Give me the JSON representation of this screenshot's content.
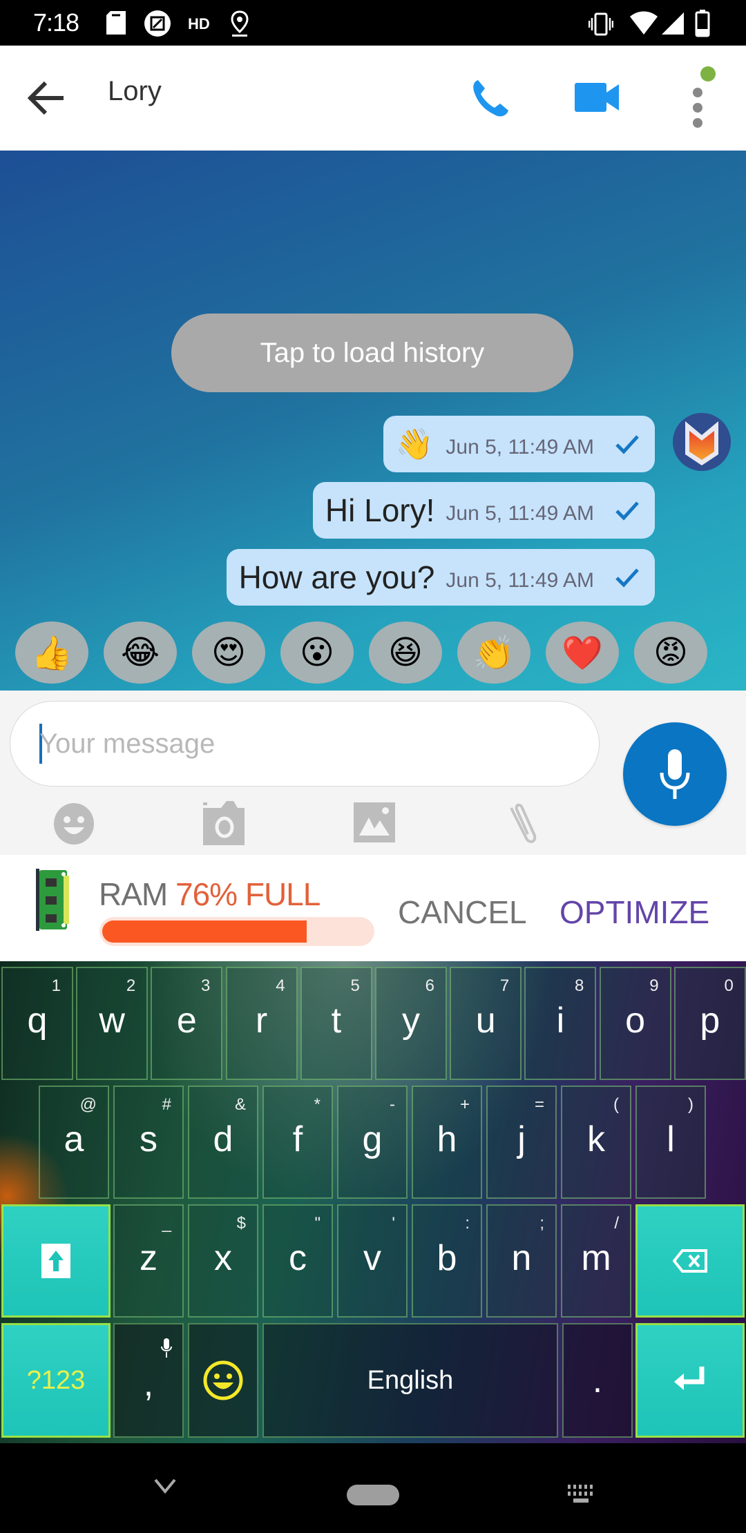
{
  "status_bar": {
    "time": "7:18",
    "left_icons": [
      "shopping-bag-icon",
      "screenshot-icon",
      "hd-icon",
      "location-icon"
    ],
    "right_icons": [
      "vibrate-icon",
      "wifi-icon",
      "signal-icon",
      "battery-icon"
    ]
  },
  "app_bar": {
    "title": "Lory",
    "actions": [
      "back-arrow-icon",
      "phone-icon",
      "video-camera-icon",
      "more-vert-icon"
    ],
    "online_status_color": "#7cb342",
    "accent_color": "#1e96f0"
  },
  "chat": {
    "load_history_label": "Tap to load history",
    "messages": [
      {
        "text": "👋",
        "timestamp": "Jun 5, 11:49 AM",
        "status": "sent",
        "is_emoji": true
      },
      {
        "text": "Hi Lory!",
        "timestamp": "Jun 5, 11:49 AM",
        "status": "sent"
      },
      {
        "text": "How are you?",
        "timestamp": "Jun 5, 11:49 AM",
        "status": "sent"
      }
    ],
    "quick_reactions": [
      "👍",
      "😂",
      "😍",
      "😮",
      "😆",
      "👏",
      "❤️",
      "😡"
    ]
  },
  "composer": {
    "placeholder": "Your message",
    "value": "",
    "tools": [
      "emoji-icon",
      "camera-icon",
      "gallery-icon",
      "attachment-icon"
    ],
    "send_button": "microphone-icon"
  },
  "ram_banner": {
    "label": "RAM",
    "percent_text": "76% FULL",
    "percent_value": 76,
    "cancel_label": "CANCEL",
    "optimize_label": "OPTIMIZE"
  },
  "keyboard": {
    "row1": [
      {
        "key": "q",
        "sub": "1"
      },
      {
        "key": "w",
        "sub": "2"
      },
      {
        "key": "e",
        "sub": "3"
      },
      {
        "key": "r",
        "sub": "4"
      },
      {
        "key": "t",
        "sub": "5"
      },
      {
        "key": "y",
        "sub": "6"
      },
      {
        "key": "u",
        "sub": "7"
      },
      {
        "key": "i",
        "sub": "8"
      },
      {
        "key": "o",
        "sub": "9"
      },
      {
        "key": "p",
        "sub": "0"
      }
    ],
    "row2": [
      {
        "key": "a",
        "sub": "@"
      },
      {
        "key": "s",
        "sub": "#"
      },
      {
        "key": "d",
        "sub": "&"
      },
      {
        "key": "f",
        "sub": "*"
      },
      {
        "key": "g",
        "sub": "-"
      },
      {
        "key": "h",
        "sub": "+"
      },
      {
        "key": "j",
        "sub": "="
      },
      {
        "key": "k",
        "sub": "("
      },
      {
        "key": "l",
        "sub": ")"
      }
    ],
    "row3": [
      {
        "key": "z",
        "sub": "_"
      },
      {
        "key": "x",
        "sub": "$"
      },
      {
        "key": "c",
        "sub": "\""
      },
      {
        "key": "v",
        "sub": "'"
      },
      {
        "key": "b",
        "sub": ":"
      },
      {
        "key": "n",
        "sub": ";"
      },
      {
        "key": "m",
        "sub": "/"
      }
    ],
    "symbols_label": "?123",
    "comma": ",",
    "space_label": "English",
    "period": "."
  },
  "nav_bar": {
    "buttons": [
      "hide-keyboard-icon",
      "home-pill-icon",
      "keyboard-switch-icon"
    ]
  }
}
